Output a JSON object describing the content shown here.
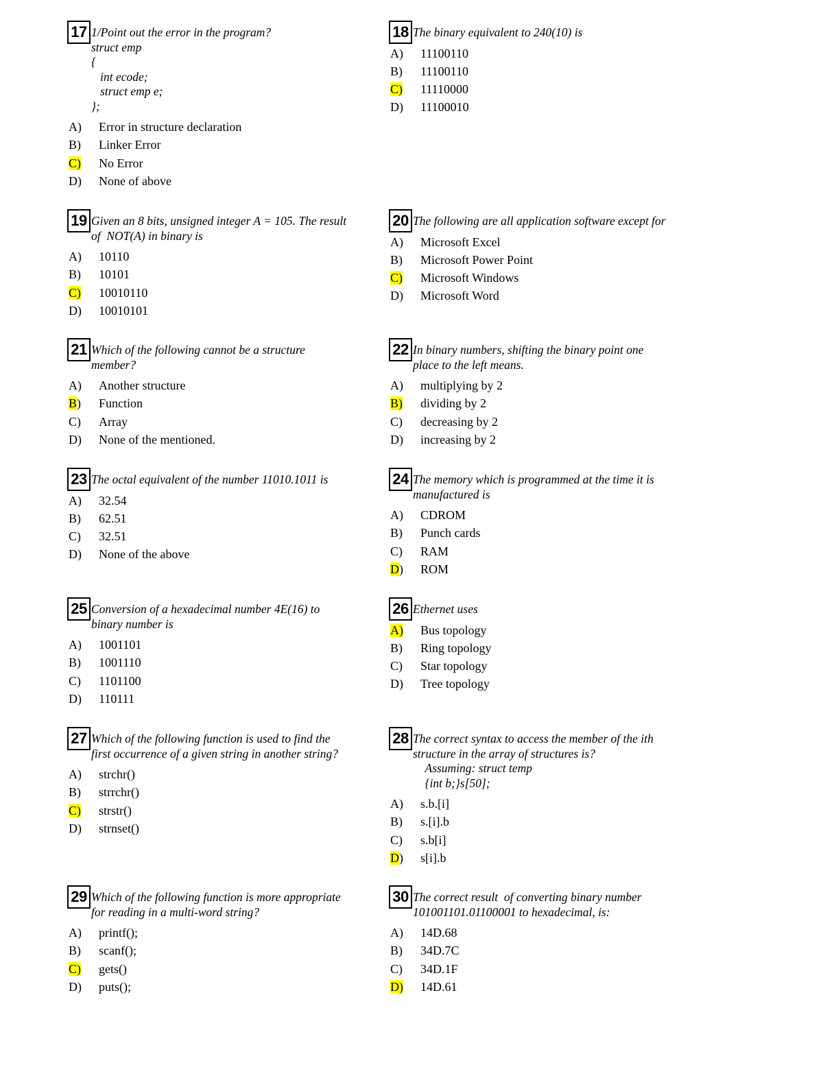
{
  "highlight_color": "#ffff00",
  "questions": [
    {
      "number": "17",
      "stem": "1/Point out the error in the program?\nstruct emp\n{\n   int ecode;\n   struct emp e;\n};",
      "options": [
        {
          "label": "A)",
          "text": "Error in structure declaration"
        },
        {
          "label": "B)",
          "text": "Linker Error"
        },
        {
          "label": "C)",
          "text": "No Error"
        },
        {
          "label": "D)",
          "text": "None of above"
        }
      ],
      "answer": "C",
      "highlight": "C)"
    },
    {
      "number": "18",
      "stem": "The binary equivalent to 240(10) is",
      "options": [
        {
          "label": "A)",
          "text": "11100110"
        },
        {
          "label": "B)",
          "text": "11100110"
        },
        {
          "label": "C)",
          "text": "11110000"
        },
        {
          "label": "D)",
          "text": "11100010"
        }
      ],
      "answer": "C",
      "highlight": "C)"
    },
    {
      "number": "19",
      "stem": "Given an 8 bits, unsigned integer A = 105. The result\nof  NOT(A) in binary is",
      "options": [
        {
          "label": "A)",
          "text": "10110"
        },
        {
          "label": "B)",
          "text": "10101"
        },
        {
          "label": "C)",
          "text": "10010110"
        },
        {
          "label": "D)",
          "text": "10010101"
        }
      ],
      "answer": "C",
      "highlight": "C)"
    },
    {
      "number": "20",
      "stem": "The following are all application software except for",
      "options": [
        {
          "label": "A)",
          "text": "Microsoft Excel"
        },
        {
          "label": "B)",
          "text": "Microsoft Power Point"
        },
        {
          "label": "C)",
          "text": "Microsoft Windows"
        },
        {
          "label": "D)",
          "text": "Microsoft Word"
        }
      ],
      "answer": "C",
      "highlight": "C)"
    },
    {
      "number": "21",
      "stem": "Which of the following cannot be a structure\nmember?",
      "options": [
        {
          "label": "A)",
          "text": "Another structure"
        },
        {
          "label": "B)",
          "text": "Function"
        },
        {
          "label": "C)",
          "text": "Array"
        },
        {
          "label": "D)",
          "text": "None of the mentioned."
        }
      ],
      "answer": "B",
      "highlight": "B"
    },
    {
      "number": "22",
      "stem": "In binary numbers, shifting the binary point one\nplace to the left means.",
      "options": [
        {
          "label": "A)",
          "text": "multiplying by 2"
        },
        {
          "label": "B)",
          "text": "dividing by 2"
        },
        {
          "label": "C)",
          "text": "decreasing by 2"
        },
        {
          "label": "D)",
          "text": "increasing by 2"
        }
      ],
      "answer": "B",
      "highlight": "B)"
    },
    {
      "number": "23",
      "stem": "The octal equivalent of the number 11010.1011 is",
      "options": [
        {
          "label": "A)",
          "text": "32.54"
        },
        {
          "label": "B)",
          "text": "62.51"
        },
        {
          "label": "C)",
          "text": "32.51"
        },
        {
          "label": "D)",
          "text": "None of the above"
        }
      ],
      "answer": "",
      "highlight": ""
    },
    {
      "number": "24",
      "stem": "The memory which is programmed at the time it is\nmanufactured is",
      "options": [
        {
          "label": "A)",
          "text": "CDROM"
        },
        {
          "label": "B)",
          "text": "Punch cards"
        },
        {
          "label": "C)",
          "text": "RAM"
        },
        {
          "label": "D)",
          "text": "ROM"
        }
      ],
      "answer": "D",
      "highlight": "D"
    },
    {
      "number": "25",
      "stem": "Conversion of a hexadecimal number 4E(16) to\nbinary number is",
      "options": [
        {
          "label": "A)",
          "text": "1001101"
        },
        {
          "label": "B)",
          "text": "1001110"
        },
        {
          "label": "C)",
          "text": "1101100"
        },
        {
          "label": "D)",
          "text": "110111"
        }
      ],
      "answer": "",
      "highlight": ""
    },
    {
      "number": "26",
      "stem": "Ethernet uses",
      "options": [
        {
          "label": "A)",
          "text": "Bus topology"
        },
        {
          "label": "B)",
          "text": "Ring topology"
        },
        {
          "label": "C)",
          "text": "Star topology"
        },
        {
          "label": "D)",
          "text": "Tree topology"
        }
      ],
      "answer": "A",
      "highlight": "A)"
    },
    {
      "number": "27",
      "stem": "Which of the following function is used to find the\nfirst occurrence of a given string in another string?",
      "options": [
        {
          "label": "A)",
          "text": "strchr()"
        },
        {
          "label": "B)",
          "text": "strrchr()"
        },
        {
          "label": "C)",
          "text": "strstr()"
        },
        {
          "label": "D)",
          "text": "strnset()"
        }
      ],
      "answer": "C",
      "highlight": "C)"
    },
    {
      "number": "28",
      "stem": "The correct syntax to access the member of the ith\nstructure in the array of structures is?\n    Assuming: struct temp\n    {int b;}s[50];",
      "options": [
        {
          "label": "A)",
          "text": "s.b.[i]"
        },
        {
          "label": "B)",
          "text": "s.[i].b"
        },
        {
          "label": "C)",
          "text": "s.b[i]"
        },
        {
          "label": "D)",
          "text": "s[i].b"
        }
      ],
      "answer": "D",
      "highlight": "D"
    },
    {
      "number": "29",
      "stem": "Which of the following function is more appropriate\nfor reading in a multi-word string?",
      "options": [
        {
          "label": "A)",
          "text": "printf();"
        },
        {
          "label": "B)",
          "text": "scanf();"
        },
        {
          "label": "C)",
          "text": "gets()"
        },
        {
          "label": "D)",
          "text": "puts();"
        }
      ],
      "answer": "C",
      "highlight": "C)"
    },
    {
      "number": "30",
      "stem": "The correct result  of converting binary number\n101001101.01100001 to hexadecimal, is:",
      "options": [
        {
          "label": "A)",
          "text": "14D.68"
        },
        {
          "label": "B)",
          "text": "34D.7C"
        },
        {
          "label": "C)",
          "text": "34D.1F"
        },
        {
          "label": "D)",
          "text": "14D.61"
        }
      ],
      "answer": "D",
      "highlight": "D)"
    }
  ]
}
